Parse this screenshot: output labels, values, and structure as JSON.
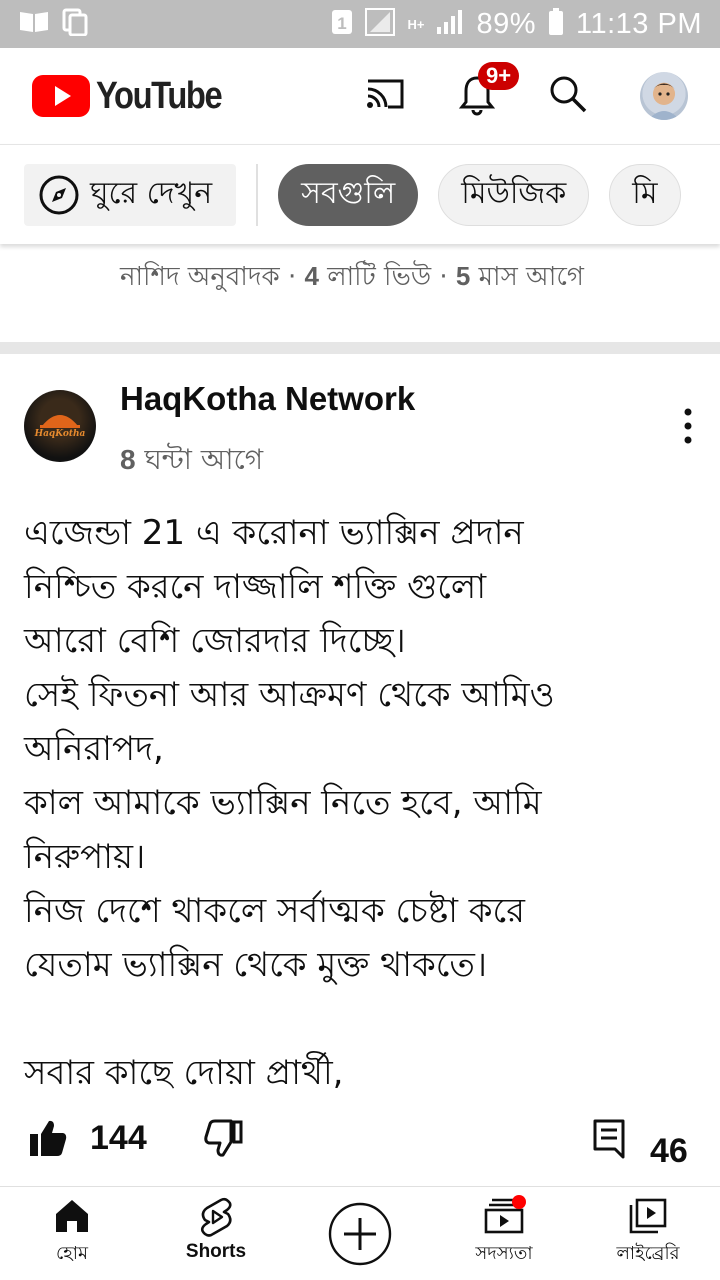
{
  "status_bar": {
    "battery": "89%",
    "time": "11:13 PM",
    "sim": "1",
    "network": "H+"
  },
  "app_bar": {
    "logo_text": "YouTube",
    "notification_badge": "9+",
    "brand_color": "#ff0000"
  },
  "chips": {
    "explore_label": "ঘুরে দেখুন",
    "items": [
      "সবগুলি",
      "মিউজিক",
      "মি"
    ],
    "active_index": 0
  },
  "previous_item": {
    "channel": "নাশিদ অনুবাদক",
    "views_count": "4",
    "views_suffix": "লাটি ভিউ",
    "age_count": "5",
    "age_suffix": "মাস আগে",
    "separator": "·"
  },
  "post": {
    "channel": "HaqKotha Network",
    "avatar_text": "HaqKotha",
    "time_count": "8",
    "time_suffix": "ঘন্টা আগে",
    "body_lines": [
      "এজেন্ডা 21 এ করোনা ভ্যাক্সিন প্রদান",
      "নিশ্চিত করনে দাজ্জালি শক্তি গুলো",
      "আরো বেশি জোরদার দিচ্ছে।",
      "সেই ফিতনা আর আক্রমণ থেকে আমিও",
      "অনিরাপদ,",
      "কাল আমাকে ভ্যাক্সিন নিতে হবে, আমি",
      "নিরুপায়।",
      "নিজ দেশে থাকলে সর্বাত্মক চেষ্টা করে",
      "যেতাম ভ্যাক্সিন থেকে মুক্ত থাকতে।",
      "",
      "সবার কাছে দোয়া প্রার্থী,"
    ],
    "likes": "144",
    "comments": "46"
  },
  "bottom_nav": [
    {
      "label": "হোম",
      "icon": "home-icon"
    },
    {
      "label": "Shorts",
      "icon": "shorts-icon"
    },
    {
      "label": "",
      "icon": "create-icon"
    },
    {
      "label": "সদস্যতা",
      "icon": "subscriptions-icon"
    },
    {
      "label": "লাইব্রেরি",
      "icon": "library-icon"
    }
  ]
}
